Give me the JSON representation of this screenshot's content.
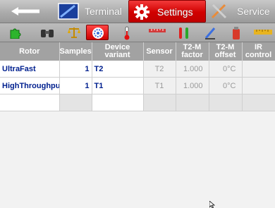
{
  "tabs": {
    "back_icon": "back-arrow-icon",
    "terminal": {
      "label": "Terminal",
      "icon": "terminal-icon"
    },
    "settings": {
      "label": "Settings",
      "icon": "gear-icon",
      "color": "#d10000"
    },
    "service": {
      "label": "Service",
      "icon": "tools-icon"
    }
  },
  "toolbar": {
    "items": [
      {
        "icon": "puzzle-icon"
      },
      {
        "icon": "binoculars-icon"
      },
      {
        "icon": "balance-scale-icon"
      },
      {
        "icon": "rotor-icon",
        "active": true
      },
      {
        "icon": "thermometer-icon"
      },
      {
        "icon": "ruler-icon"
      },
      {
        "icon": "test-tubes-icon"
      },
      {
        "icon": "pipette-icon"
      },
      {
        "icon": "canister-icon"
      },
      {
        "icon": "tape-icon"
      }
    ]
  },
  "table": {
    "headers": [
      "Rotor",
      "Samples",
      "Device variant",
      "Sensor",
      "T2-M factor",
      "T2-M offset",
      "IR control"
    ],
    "header_lines": [
      [
        "Rotor"
      ],
      [
        "Samples"
      ],
      [
        "Device",
        "variant"
      ],
      [
        "Sensor"
      ],
      [
        "T2-M",
        "factor"
      ],
      [
        "T2-M",
        "offset"
      ],
      [
        "IR",
        "control"
      ]
    ],
    "rows": [
      {
        "rotor": "UltraFast",
        "samples": "1",
        "variant": "T2",
        "sensor": "T2",
        "factor": "1.000",
        "offset": "0°C",
        "ir": ""
      },
      {
        "rotor": "HighThroughput",
        "samples": "1",
        "variant": "T1",
        "sensor": "T1",
        "factor": "1.000",
        "offset": "0°C",
        "ir": ""
      }
    ]
  }
}
